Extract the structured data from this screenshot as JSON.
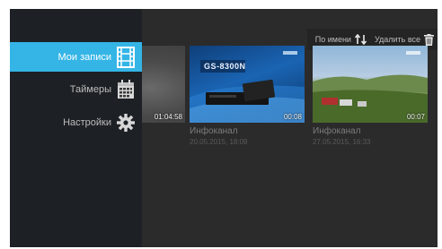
{
  "menu": {
    "items": [
      {
        "label": "Мои записи",
        "icon": "film-icon",
        "active": true
      },
      {
        "label": "Таймеры",
        "icon": "calendar-icon",
        "active": false
      },
      {
        "label": "Настройки",
        "icon": "gear-icon",
        "active": false
      }
    ]
  },
  "toolbar": {
    "sort_label": "По имени",
    "sort_icon": "sort-arrows-icon",
    "delete_label": "Удалить все",
    "delete_icon": "trash-icon"
  },
  "recordings": [
    {
      "title": "",
      "date": "",
      "duration": "01:04:58"
    },
    {
      "title": "Инфоканал",
      "date": "20.05.2015, 18:09",
      "duration": "00:08",
      "thumb_text": "GS-8300N"
    },
    {
      "title": "Инфоканал",
      "date": "27.05.2015, 16:33",
      "duration": "00:07"
    }
  ],
  "colors": {
    "accent": "#34b5e6",
    "sidebar": "#1d2125",
    "background": "#2b2b2b"
  }
}
